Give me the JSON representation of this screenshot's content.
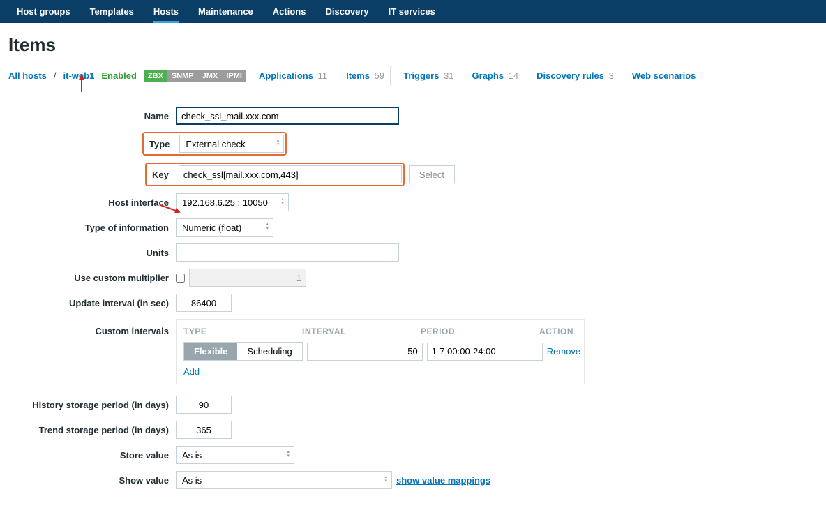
{
  "nav": {
    "items": [
      "Host groups",
      "Templates",
      "Hosts",
      "Maintenance",
      "Actions",
      "Discovery",
      "IT services"
    ],
    "active": "Hosts"
  },
  "page": {
    "title": "Items"
  },
  "breadcrumb": {
    "all_hosts": "All hosts",
    "host": "it-web1",
    "status": "Enabled",
    "badges": [
      "ZBX",
      "SNMP",
      "JMX",
      "IPMI"
    ]
  },
  "tabs": [
    {
      "label": "Applications",
      "count": "11"
    },
    {
      "label": "Items",
      "count": "59",
      "selected": true
    },
    {
      "label": "Triggers",
      "count": "31"
    },
    {
      "label": "Graphs",
      "count": "14"
    },
    {
      "label": "Discovery rules",
      "count": "3"
    },
    {
      "label": "Web scenarios",
      "count": ""
    }
  ],
  "form": {
    "name_label": "Name",
    "name_value": "check_ssl_mail.xxx.com",
    "type_label": "Type",
    "type_value": "External check",
    "key_label": "Key",
    "key_value": "check_ssl[mail.xxx.com,443]",
    "select_btn": "Select",
    "hostif_label": "Host interface",
    "hostif_value": "192.168.6.25 : 10050",
    "toi_label": "Type of information",
    "toi_value": "Numeric (float)",
    "units_label": "Units",
    "units_value": "",
    "multiplier_label": "Use custom multiplier",
    "multiplier_value": "1",
    "update_label": "Update interval (in sec)",
    "update_value": "86400",
    "ci_label": "Custom intervals",
    "ci_head": {
      "type": "TYPE",
      "interval": "INTERVAL",
      "period": "PERIOD",
      "action": "ACTION"
    },
    "ci_row": {
      "flexible": "Flexible",
      "scheduling": "Scheduling",
      "interval": "50",
      "period": "1-7,00:00-24:00",
      "remove": "Remove"
    },
    "ci_add": "Add",
    "history_label": "History storage period (in days)",
    "history_value": "90",
    "trend_label": "Trend storage period (in days)",
    "trend_value": "365",
    "store_label": "Store value",
    "store_value": "As is",
    "show_label": "Show value",
    "show_value": "As is",
    "show_link": "show value mappings"
  }
}
